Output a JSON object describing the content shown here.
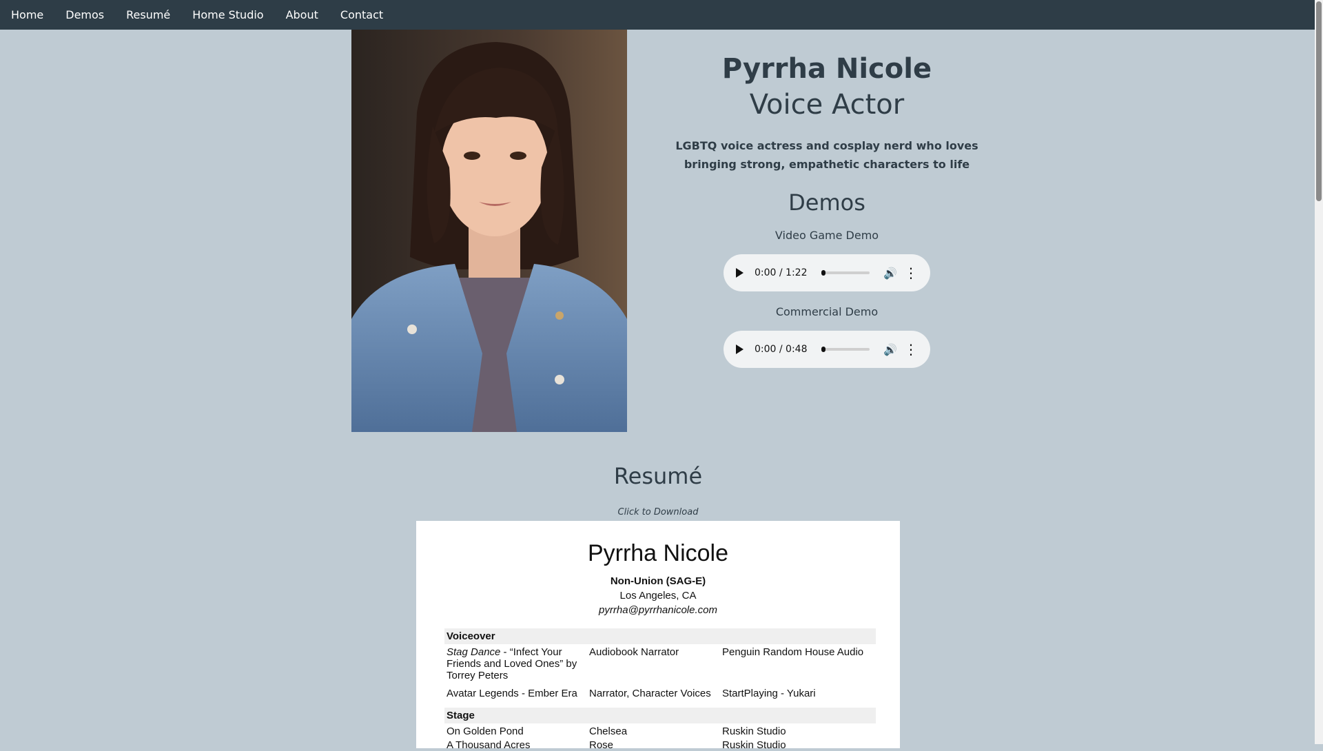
{
  "nav": [
    "Home",
    "Demos",
    "Resumé",
    "Home Studio",
    "About",
    "Contact"
  ],
  "hero": {
    "name": "Pyrrha Nicole",
    "role": "Voice Actor",
    "tagline": "LGBTQ voice actress and cosplay nerd who loves bringing strong, empathetic characters to life"
  },
  "demos": {
    "heading": "Demos",
    "items": [
      {
        "label": "Video Game Demo",
        "time": "0:00 / 1:22"
      },
      {
        "label": "Commercial Demo",
        "time": "0:00 / 0:48"
      }
    ]
  },
  "resume": {
    "heading": "Resumé",
    "download": "Click to Download",
    "doc": {
      "name": "Pyrrha Nicole",
      "union": "Non-Union (SAG-E)",
      "location": "Los Angeles, CA",
      "email": "pyrrha@pyrrhanicole.com",
      "voiceover": {
        "heading": "Voiceover",
        "rows": [
          {
            "title_italic": "Stag Dance",
            "title_rest": " - “Infect Your Friends and Loved Ones” by Torrey Peters",
            "role": "Audiobook Narrator",
            "org": "Penguin Random House Audio"
          },
          {
            "title_italic": "",
            "title_rest": "Avatar Legends - Ember Era",
            "role": "Narrator, Character Voices",
            "org": "StartPlaying - Yukari"
          }
        ]
      },
      "stage": {
        "heading": "Stage",
        "rows": [
          {
            "title": "On Golden Pond",
            "role": "Chelsea",
            "org": "Ruskin Studio"
          },
          {
            "title": "A Thousand Acres",
            "role": "Rose",
            "org": "Ruskin Studio"
          }
        ]
      }
    }
  },
  "colors": {
    "nav_bg": "#2e3d47",
    "page_bg": "#bfcbd3",
    "text": "#2f3d47"
  }
}
